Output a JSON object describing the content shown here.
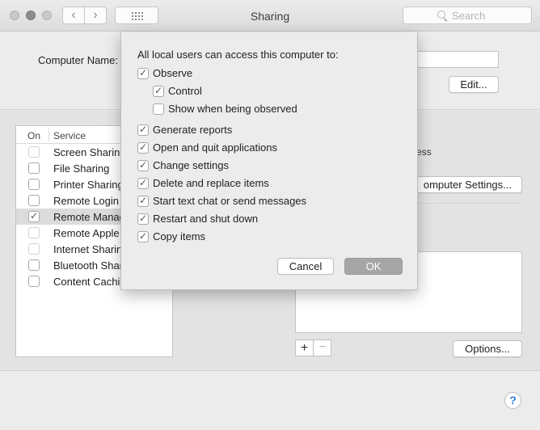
{
  "window": {
    "title": "Sharing",
    "search_placeholder": "Search"
  },
  "toolbar": {
    "back_glyph": "‹",
    "forward_glyph": "›"
  },
  "main": {
    "computer_name_label": "Computer Name:",
    "edit_button": "Edit...",
    "address_fragment": "ress",
    "computer_settings_button": "omputer Settings...",
    "options_button": "Options...",
    "help_button": "?"
  },
  "services": {
    "header_on": "On",
    "header_service": "Service",
    "items": [
      {
        "label": "Screen Sharing",
        "checked": false,
        "enabled": false
      },
      {
        "label": "File Sharing",
        "checked": false,
        "enabled": true
      },
      {
        "label": "Printer Sharing",
        "checked": false,
        "enabled": true
      },
      {
        "label": "Remote Login",
        "checked": false,
        "enabled": true
      },
      {
        "label": "Remote Manag",
        "checked": true,
        "enabled": true,
        "selected": true
      },
      {
        "label": "Remote Apple",
        "checked": false,
        "enabled": false
      },
      {
        "label": "Internet Sharin",
        "checked": false,
        "enabled": false
      },
      {
        "label": "Bluetooth Shar",
        "checked": false,
        "enabled": true
      },
      {
        "label": "Content Cachin",
        "checked": false,
        "enabled": true
      }
    ]
  },
  "user_list": {
    "add_glyph": "+",
    "remove_glyph": "−"
  },
  "sheet": {
    "title": "All local users can access this computer to:",
    "options": [
      {
        "label": "Observe",
        "checked": true
      },
      {
        "label": "Control",
        "checked": true
      },
      {
        "label": "Show when being observed",
        "checked": false
      },
      {
        "label": "Generate reports",
        "checked": true
      },
      {
        "label": "Open and quit applications",
        "checked": true
      },
      {
        "label": "Change settings",
        "checked": true
      },
      {
        "label": "Delete and replace items",
        "checked": true
      },
      {
        "label": "Start text chat or send messages",
        "checked": true
      },
      {
        "label": "Restart and shut down",
        "checked": true
      },
      {
        "label": "Copy items",
        "checked": true
      }
    ],
    "cancel_button": "Cancel",
    "ok_button": "OK"
  }
}
